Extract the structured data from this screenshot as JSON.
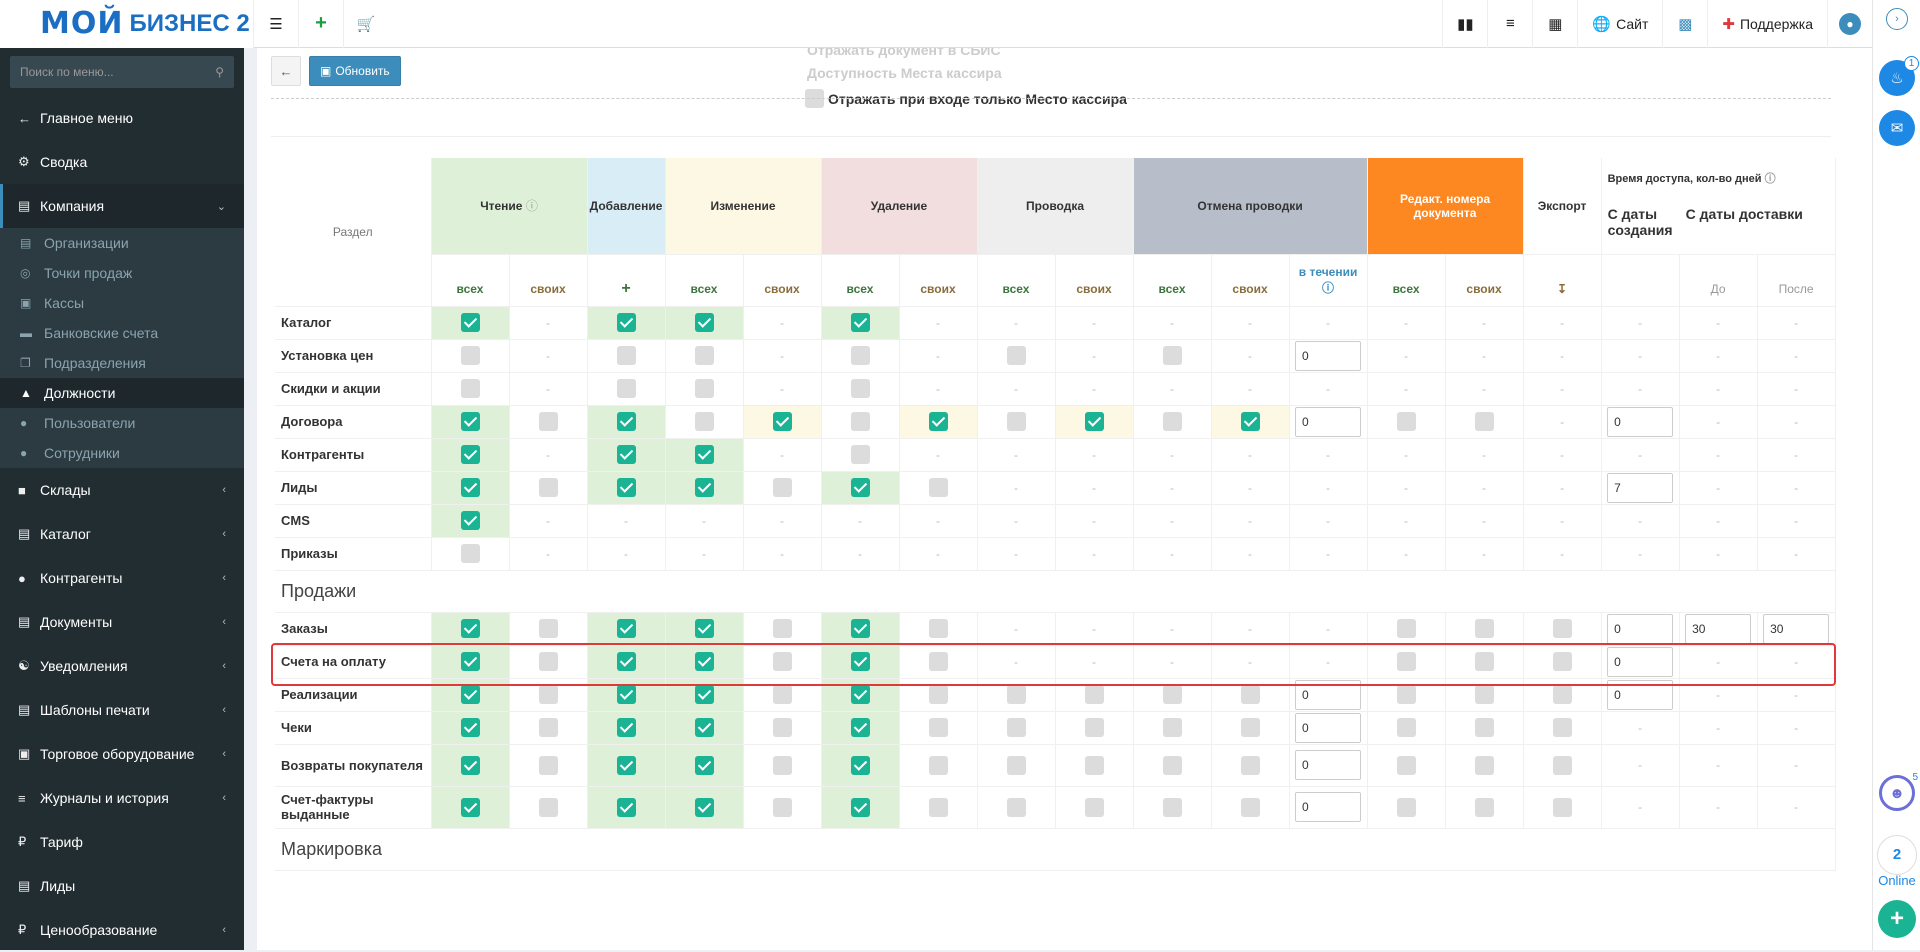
{
  "logo": {
    "line1": "МОЙ",
    "line2": "БИЗНЕС 2"
  },
  "topbar": {
    "site": "Сайт",
    "support": "Поддержка"
  },
  "sidebar": {
    "search_placeholder": "Поиск по меню...",
    "items": [
      {
        "label": "Главное меню",
        "icon": "arrow-left-icon"
      },
      {
        "label": "Сводка",
        "icon": "gear-icon"
      },
      {
        "label": "Компания",
        "icon": "chart-icon"
      }
    ],
    "sub": [
      "Организации",
      "Точки продаж",
      "Кассы",
      "Банковские счета",
      "Подразделения",
      "Должности",
      "Пользователи",
      "Сотрудники"
    ],
    "items2": [
      "Склады",
      "Каталог",
      "Контрагенты",
      "Документы",
      "Уведомления",
      "Шаблоны печати",
      "Торговое оборудование",
      "Журналы и история",
      "Тариф",
      "Лиды",
      "Ценообразование"
    ]
  },
  "rightstrip": {
    "badge_bell": "1",
    "badge_chat": "5",
    "online_count": "2",
    "online": "Online"
  },
  "toolbar": {
    "refresh": "Обновить"
  },
  "faded": [
    "Отражать документ в СБИС",
    "Доступность Места кассира",
    "Отражать при входе только Место кассира"
  ],
  "headers": {
    "section": "Раздел",
    "read": "Чтение",
    "add": "Добавление",
    "edit": "Изменение",
    "delete": "Удаление",
    "post": "Проводка",
    "unpost": "Отмена проводки",
    "docnum": "Редакт. номера документа",
    "export": "Экспорт",
    "access": "Время доступа, кол-во дней",
    "from_create": "С даты создания",
    "from_delivery": "С даты доставки",
    "during": "в течении",
    "all": "всех",
    "own": "своих",
    "before": "До",
    "after": "После"
  },
  "rows": [
    {
      "label": "Каталог",
      "c": [
        "on",
        "-",
        "on",
        "on",
        "-",
        "on",
        "-",
        "-",
        "-",
        "-",
        "-",
        "-",
        "-",
        "-",
        "-",
        "-",
        "-",
        "-"
      ]
    },
    {
      "label": "Установка цен",
      "c": [
        "off",
        "-",
        "off",
        "off",
        "-",
        "off",
        "-",
        "off",
        "-",
        "off",
        "-",
        "0",
        "-",
        "-",
        "-",
        "-",
        "-",
        "-"
      ]
    },
    {
      "label": "Скидки и акции",
      "c": [
        "off",
        "-",
        "off",
        "off",
        "-",
        "off",
        "-",
        "-",
        "-",
        "-",
        "-",
        "-",
        "-",
        "-",
        "-",
        "-",
        "-",
        "-"
      ]
    },
    {
      "label": "Договора",
      "c": [
        "on",
        "off",
        "on",
        "off",
        "on",
        "off",
        "on",
        "off",
        "on",
        "off",
        "on",
        "0",
        "off",
        "off",
        "-",
        "0",
        "-",
        "-"
      ]
    },
    {
      "label": "Контрагенты",
      "c": [
        "on",
        "-",
        "on",
        "on",
        "-",
        "off",
        "-",
        "-",
        "-",
        "-",
        "-",
        "-",
        "-",
        "-",
        "-",
        "-",
        "-",
        "-"
      ]
    },
    {
      "label": "Лиды",
      "c": [
        "on",
        "off",
        "on",
        "on",
        "off",
        "on",
        "off",
        "-",
        "-",
        "-",
        "-",
        "-",
        "-",
        "-",
        "-",
        "7",
        "-",
        "-"
      ]
    },
    {
      "label": "CMS",
      "c": [
        "on",
        "-",
        "-",
        "-",
        "-",
        "-",
        "-",
        "-",
        "-",
        "-",
        "-",
        "-",
        "-",
        "-",
        "-",
        "-",
        "-",
        "-"
      ]
    },
    {
      "label": "Приказы",
      "c": [
        "off",
        "-",
        "-",
        "-",
        "-",
        "-",
        "-",
        "-",
        "-",
        "-",
        "-",
        "-",
        "-",
        "-",
        "-",
        "-",
        "-",
        "-"
      ]
    }
  ],
  "section_sales": "Продажи",
  "rows2": [
    {
      "label": "Заказы",
      "c": [
        "on",
        "off",
        "on",
        "on",
        "off",
        "on",
        "off",
        "-",
        "-",
        "-",
        "-",
        "-",
        "off",
        "off",
        "off",
        "0",
        "30",
        "30"
      ]
    },
    {
      "label": "Счета на оплату",
      "c": [
        "on",
        "off",
        "on",
        "on",
        "off",
        "on",
        "off",
        "-",
        "-",
        "-",
        "-",
        "-",
        "off",
        "off",
        "off",
        "0",
        "-",
        "-"
      ]
    },
    {
      "label": "Реализации",
      "c": [
        "on",
        "off",
        "on",
        "on",
        "off",
        "on",
        "off",
        "off",
        "off",
        "off",
        "off",
        "0",
        "off",
        "off",
        "off",
        "0",
        "-",
        "-"
      ]
    },
    {
      "label": "Чеки",
      "c": [
        "on",
        "off",
        "on",
        "on",
        "off",
        "on",
        "off",
        "off",
        "off",
        "off",
        "off",
        "0",
        "off",
        "off",
        "off",
        "-",
        "-",
        "-"
      ]
    },
    {
      "label": "Возвраты покупателя",
      "c": [
        "on",
        "off",
        "on",
        "on",
        "off",
        "on",
        "off",
        "off",
        "off",
        "off",
        "off",
        "0",
        "off",
        "off",
        "off",
        "-",
        "-",
        "-"
      ]
    },
    {
      "label": "Счет-фактуры выданные",
      "c": [
        "on",
        "off",
        "on",
        "on",
        "off",
        "on",
        "off",
        "off",
        "off",
        "off",
        "off",
        "0",
        "off",
        "off",
        "off",
        "-",
        "-",
        "-"
      ]
    }
  ],
  "section_mark": "Маркировка"
}
